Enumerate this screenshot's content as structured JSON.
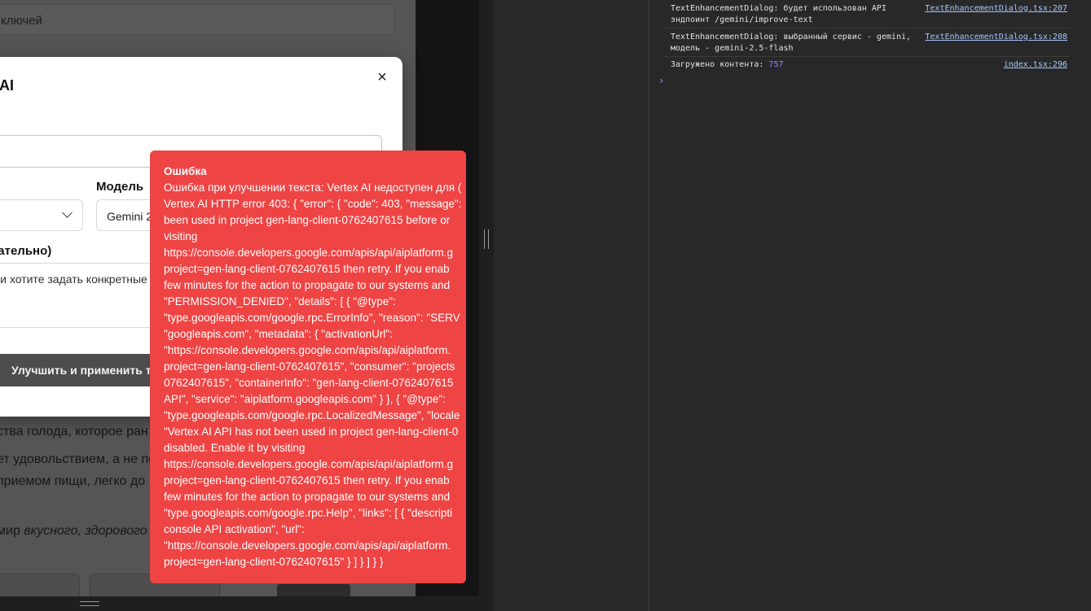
{
  "background": {
    "search_text": "ключей",
    "text_lines": [
      "ства голода, которое ран",
      "ет удовольствием, а не по",
      "приемом пищи, легко до"
    ],
    "italic_line_plain": "мир ",
    "italic_line_italic": "вкусного, здорового и"
  },
  "dialog": {
    "title": "AI",
    "close_glyph": "×",
    "model_label": "Модель",
    "model_value": "Gemini 2",
    "optional_label": "зательно)",
    "textarea_placeholder": "ли хотите задать конкретные",
    "improve_button": "Улучшить и применить те"
  },
  "error_toast": {
    "title": "Ошибка",
    "lines": [
      "Ошибка при улучшении текста: Vertex AI недоступен для (",
      "Vertex AI HTTP error 403: { \"error\": { \"code\": 403, \"message\":",
      "been used in project gen-lang-client-0762407615 before or",
      "visiting",
      "https://console.developers.google.com/apis/api/aiplatform.g",
      "project=gen-lang-client-0762407615 then retry. If you enab",
      "few minutes for the action to propagate to our systems and",
      "\"PERMISSION_DENIED\", \"details\": [ { \"@type\":",
      "\"type.googleapis.com/google.rpc.ErrorInfo\", \"reason\": \"SERV",
      "\"googleapis.com\", \"metadata\": { \"activationUrl\":",
      "\"https://console.developers.google.com/apis/api/aiplatform.",
      "project=gen-lang-client-0762407615\", \"consumer\": \"projects",
      "0762407615\", \"containerInfo\": \"gen-lang-client-0762407615",
      "API\", \"service\": \"aiplatform.googleapis.com\" } }, { \"@type\":",
      "\"type.googleapis.com/google.rpc.LocalizedMessage\", \"locale",
      "\"Vertex AI API has not been used in project gen-lang-client-0",
      "disabled. Enable it by visiting",
      "https://console.developers.google.com/apis/api/aiplatform.g",
      "project=gen-lang-client-0762407615 then retry. If you enab",
      "few minutes for the action to propagate to our systems and",
      "\"type.googleapis.com/google.rpc.Help\", \"links\": [ { \"descripti",
      "console API activation\", \"url\":",
      "\"https://console.developers.google.com/apis/api/aiplatform.",
      "project=gen-lang-client-0762407615\" } ] } ] } }"
    ]
  },
  "console": {
    "entries": [
      {
        "line1": "TextEnhancementDialog: будет использован API",
        "line2": "эндпоинт /gemini/improve-text",
        "source": "TextEnhancementDialog.tsx:207"
      },
      {
        "line1": "TextEnhancementDialog: выбранный сервис - gemini,",
        "line2": "модель - gemini-2.5-flash",
        "source": "TextEnhancementDialog.tsx:208"
      },
      {
        "line1": "Загружено контента: ",
        "number": "757",
        "source": "index.tsx:296"
      }
    ],
    "prompt": "›"
  }
}
